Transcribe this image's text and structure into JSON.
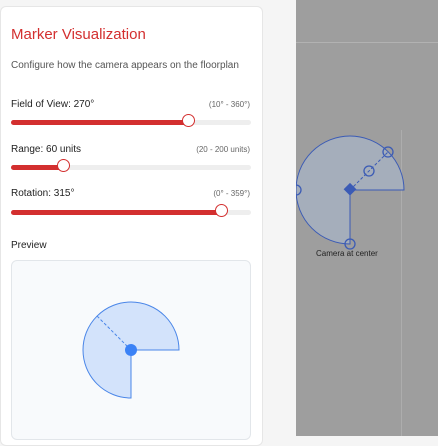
{
  "panel": {
    "title": "Marker Visualization",
    "description": "Configure how the camera appears on the floorplan",
    "accent_color": "#d32f2f"
  },
  "sliders": [
    {
      "label": "Field of View: 270°",
      "range_text": "(10° - 360°)",
      "value": 270,
      "min": 10,
      "max": 360
    },
    {
      "label": "Range: 60 units",
      "range_text": "(20 - 200 units)",
      "value": 60,
      "min": 20,
      "max": 200
    },
    {
      "label": "Rotation: 315°",
      "range_text": "(0° - 359°)",
      "value": 315,
      "min": 0,
      "max": 359
    }
  ],
  "preview": {
    "label": "Preview",
    "fill_color": "#d3e3fb",
    "stroke_color": "#4a86e8",
    "dot_color": "#3b82f6"
  },
  "floorplan": {
    "camera_caption": "Camera at center",
    "fill_color": "#a6b0bf",
    "stroke_color": "#3b5bb5"
  }
}
